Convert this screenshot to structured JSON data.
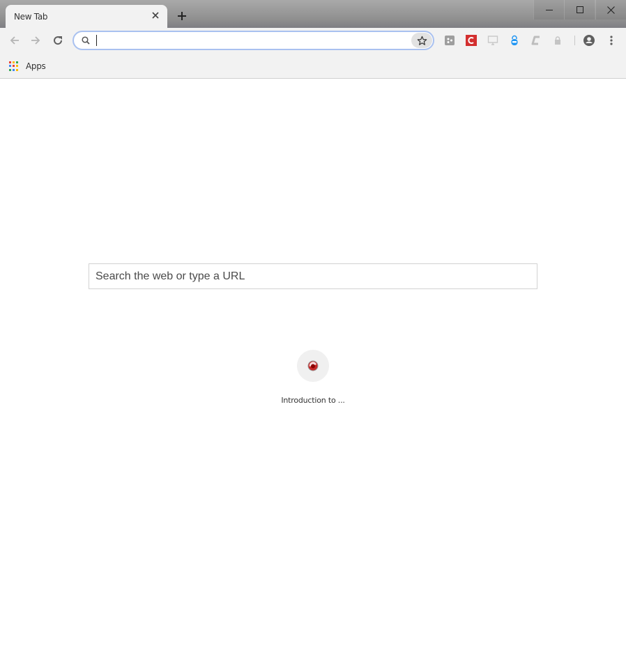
{
  "window": {
    "tabs": [
      {
        "title": "New Tab",
        "active": true
      }
    ],
    "controls": {
      "minimize": "minimize",
      "maximize": "maximize",
      "close": "close"
    }
  },
  "toolbar": {
    "back_icon": "arrow-left-icon",
    "forward_icon": "arrow-right-icon",
    "reload_icon": "reload-icon",
    "omnibox": {
      "value": "",
      "placeholder": ""
    },
    "bookmark_icon": "star-icon",
    "extensions": [
      {
        "name": "extension-grey-square",
        "color": "#9e9e9e"
      },
      {
        "name": "extension-red-c",
        "color": "#d32f2f"
      },
      {
        "name": "extension-cast",
        "color": "#c8c8c8"
      },
      {
        "name": "extension-blue-lock",
        "color": "#2196f3"
      },
      {
        "name": "extension-grey-c",
        "color": "#c0c0c0"
      },
      {
        "name": "extension-lock",
        "color": "#bdbdbd"
      }
    ],
    "profile_icon": "account-circle-icon",
    "menu_icon": "kebab-menu-icon"
  },
  "bookmarks_bar": {
    "apps_label": "Apps",
    "apps_colors": [
      "#ea4335",
      "#fbbc05",
      "#34a853",
      "#4285f4",
      "#ea4335",
      "#fbbc05",
      "#34a853",
      "#4285f4",
      "#fbbc05"
    ]
  },
  "ntp": {
    "search_placeholder": "Search the web or type a URL",
    "tiles": [
      {
        "label": "Introduction to ...",
        "icon_color": "#b71c1c"
      }
    ]
  }
}
